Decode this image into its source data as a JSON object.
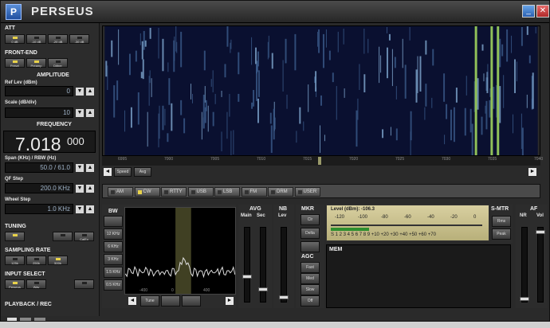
{
  "window": {
    "title": "PERSEUS",
    "app_icon": "P"
  },
  "left": {
    "att": {
      "label": "ATT",
      "buttons": [
        "0 dB",
        "-10 dB",
        "-20 dB",
        "-30 dB"
      ]
    },
    "frontend": {
      "label": "FRONT-END",
      "buttons": [
        "Presel",
        "Preamp",
        "Dither"
      ]
    },
    "amplitude": {
      "label": "AMPLITUDE",
      "ref_label": "Ref Lev (dBm)",
      "ref_value": "0",
      "scale_label": "Scale (dB/div)",
      "scale_value": "10"
    },
    "frequency": {
      "label": "FREQUENCY",
      "main": "7.018",
      "decimals": "000"
    },
    "span": {
      "label": "Span (KHz) / RBW (Hz)",
      "value": "50.0 / 61.0"
    },
    "qf_step": {
      "label": "QF Step",
      "value": "200.0 KHz"
    },
    "wheel_step": {
      "label": "Wheel Step",
      "value": "1.0 KHz"
    },
    "tuning": {
      "label": "TUNING",
      "button": "CalEx"
    },
    "sampling": {
      "label": "SAMPLING RATE",
      "buttons": [
        "125k",
        "250k",
        "500k"
      ]
    },
    "input": {
      "label": "INPUT SELECT",
      "buttons": [
        "Perseus",
        "Wav",
        ""
      ]
    },
    "playback": {
      "label": "PLAYBACK / REC"
    }
  },
  "scale_ticks": [
    "6995",
    "7000",
    "7005",
    "7010",
    "7015",
    "7020",
    "7025",
    "7030",
    "7035",
    "7040"
  ],
  "scroll": {
    "left_btn": "◄",
    "right_btn": "►",
    "speed": "Speed",
    "avg": "Avg"
  },
  "modes": [
    "AM",
    "CW",
    "RTTY",
    "USB",
    "LSB",
    "FM",
    "DRM",
    "USER"
  ],
  "active_mode": "CW",
  "bw": {
    "label": "BW",
    "buttons": [
      "",
      "12 KHz",
      "6 KHz",
      "3 KHz",
      "1.5 KHz",
      "0.5 KHz"
    ],
    "spec_ticks": [
      "-400",
      "0",
      "400"
    ],
    "tune_btn": "Tune"
  },
  "avg": {
    "label": "AVG",
    "main": "Main",
    "sec": "Sec"
  },
  "nb": {
    "label": "NB",
    "lev": "Lev"
  },
  "mkr": {
    "label": "MKR",
    "buttons": [
      "Clr",
      "Delta",
      ""
    ]
  },
  "agc": {
    "label": "AGC",
    "buttons": [
      "Fast",
      "Med",
      "Slow",
      "Off"
    ]
  },
  "meter": {
    "level_text": "Level (dBm): -106.3",
    "top_scale": [
      "-120",
      "-100",
      "-80",
      "-60",
      "-40",
      "-20",
      "0"
    ],
    "bottom_scale": "S 1 2 3 4 5 6 7 8 9 +10 +20 +30 +40 +50 +60 +70"
  },
  "smtr": {
    "label": "S-MTR",
    "buttons": [
      "Rms",
      "Peak"
    ]
  },
  "mem": {
    "label": "MEM"
  },
  "af": {
    "label": "AF",
    "nr": "NR",
    "vol": "Vol"
  },
  "colors": {
    "waterfall_bg": "#0a1030",
    "waterfall_signal": "#a8e060",
    "accent": "#e8d24a"
  }
}
